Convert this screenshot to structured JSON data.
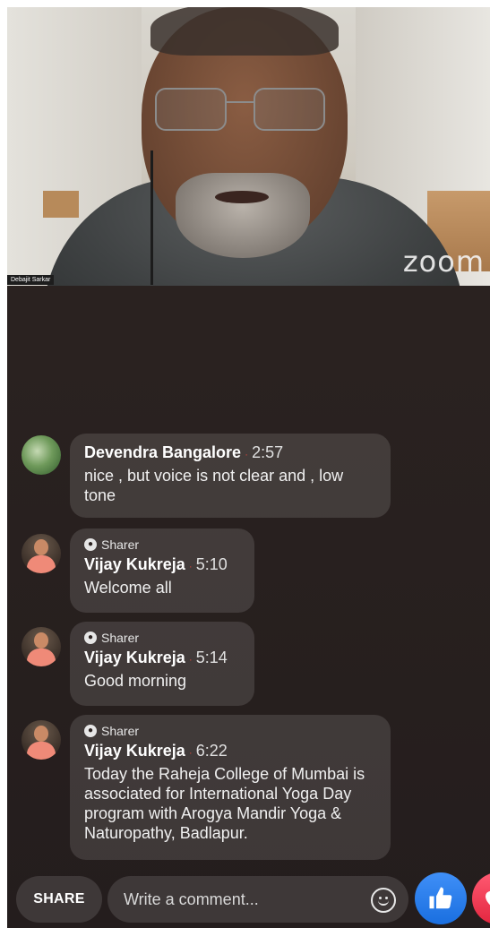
{
  "video": {
    "logo": "zoom",
    "participant_name": "Debajit Sarkar"
  },
  "comments": [
    {
      "author": "Devendra Bangalore",
      "time": "2:57",
      "text": "nice , but voice is not clear and , low tone",
      "sharer": null,
      "avatar": "leaf-avatar"
    },
    {
      "sharer": "Sharer",
      "author": "Vijay Kukreja",
      "time": "5:10",
      "text": "Welcome all",
      "avatar": "person-avatar"
    },
    {
      "sharer": "Sharer",
      "author": "Vijay Kukreja",
      "time": "5:14",
      "text": "Good morning",
      "avatar": "person-avatar"
    },
    {
      "sharer": "Sharer",
      "author": "Vijay Kukreja",
      "time": "6:22",
      "text": "Today the Raheja College of Mumbai is associated for International Yoga Day program with Arogya Mandir Yoga & Naturopathy, Badlapur.",
      "avatar": "person-avatar"
    }
  ],
  "bottom_bar": {
    "share_label": "SHARE",
    "comment_placeholder": "Write a comment...",
    "icons": [
      "emoji-icon",
      "like-icon",
      "love-icon"
    ]
  },
  "colors": {
    "like_blue": "#1a6fe0",
    "love_red": "#e3263f",
    "dot_red": "#c2433a"
  }
}
